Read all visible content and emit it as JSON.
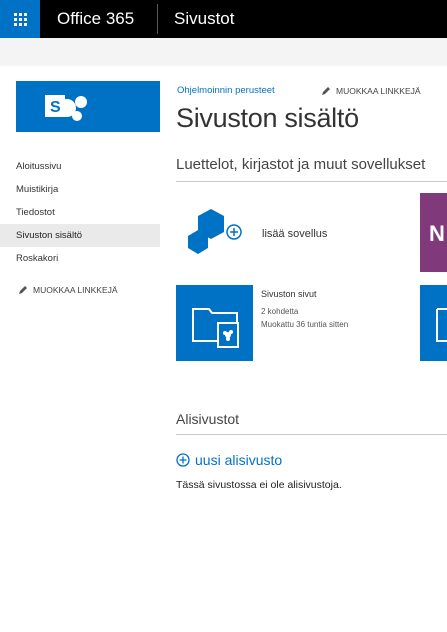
{
  "suitebar": {
    "brand": "Office 365",
    "app_title": "Sivustot",
    "icons": {
      "app_launcher": "waffle-icon"
    }
  },
  "site": {
    "logo_icon": "sharepoint-logo-icon",
    "colors": {
      "accent": "#0072c6",
      "suite_bar": "#000000",
      "onenote": "#80397b"
    }
  },
  "leftnav": {
    "items": [
      {
        "label": "Aloitussivu"
      },
      {
        "label": "Muistikirja"
      },
      {
        "label": "Tiedostot"
      },
      {
        "label": "Sivuston sisältö",
        "selected": true
      },
      {
        "label": "Roskakori"
      }
    ],
    "edit_links": "MUOKKAA LINKKEJÄ"
  },
  "header": {
    "breadcrumb": "Ohjelmoinnin perusteet",
    "edit_links": "MUOKKAA LINKKEJÄ",
    "title": "Sivuston sisältö"
  },
  "content": {
    "section_title": "Luettelot, kirjastot ja muut sovellukset",
    "add_app_label": "lisää sovellus",
    "onenote_letter": "N",
    "library": {
      "title": "Sivuston sivut",
      "count": "2 kohdetta",
      "modified": "Muokattu 36 tuntia sitten"
    }
  },
  "subsites": {
    "title": "Alisivustot",
    "new_label": "uusi alisivusto",
    "empty_text": "Tässä sivustossa ei ole alisivustoja."
  }
}
